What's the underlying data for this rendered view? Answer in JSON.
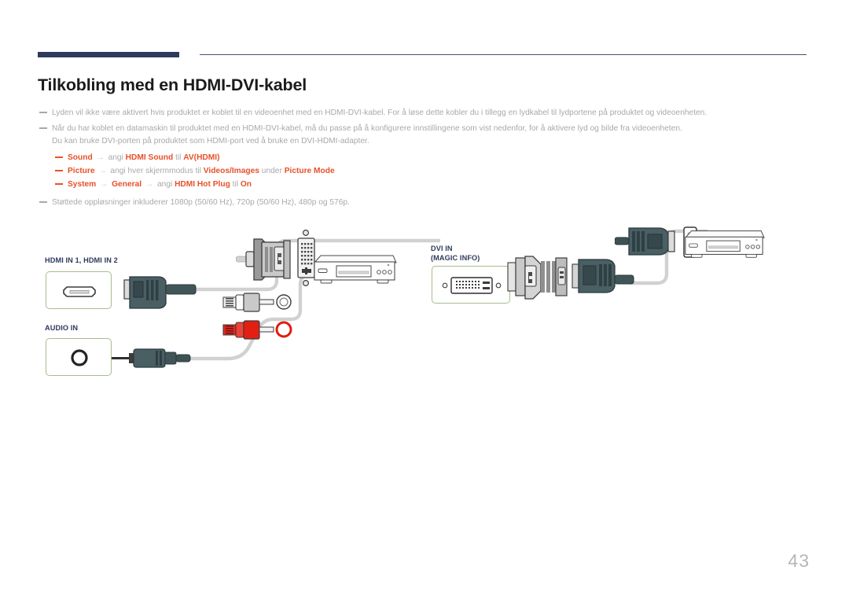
{
  "page": {
    "number": "43",
    "title": "Tilkobling med en HDMI-DVI-kabel",
    "accent_navy": "#2e3a5c",
    "accent_orange": "#e8502a",
    "port_border_green": "#a7bb8e",
    "body_grey": "#a7a9ac"
  },
  "notes": [
    {
      "id": "note-audio",
      "lines": [
        "Lyden vil ikke være aktivert hvis produktet er koblet til en videoenhet med en HDMI-DVI-kabel. For å løse dette kobler du i tillegg en lydkabel til lydportene på produktet og videoenheten."
      ]
    },
    {
      "id": "note-pc",
      "lines": [
        "Når du har koblet en datamaskin til produktet med en HDMI-DVI-kabel, må du passe på å konfigurere innstillingene som vist nedenfor, for å aktivere lyd og bilde fra videoenheten.",
        "Du kan bruke DVI-porten på produktet som HDMI-port ved å bruke en DVI-HDMI-adapter."
      ]
    }
  ],
  "subnotes": [
    {
      "id": "subnote-sound",
      "segments": [
        {
          "text": "Sound",
          "style": "kw"
        },
        {
          "text": "→",
          "style": "arr"
        },
        {
          "text": "angi",
          "style": "plain"
        },
        {
          "text": "HDMI Sound",
          "style": "kw"
        },
        {
          "text": "til",
          "style": "plain"
        },
        {
          "text": "AV(HDMI)",
          "style": "kw"
        }
      ]
    },
    {
      "id": "subnote-picture",
      "segments": [
        {
          "text": "Picture",
          "style": "kw"
        },
        {
          "text": "→",
          "style": "arr"
        },
        {
          "text": "angi hver skjermmodus til",
          "style": "plain"
        },
        {
          "text": "Videos/Images",
          "style": "kw"
        },
        {
          "text": "under",
          "style": "plain"
        },
        {
          "text": "Picture Mode",
          "style": "kw"
        }
      ]
    },
    {
      "id": "subnote-system",
      "segments": [
        {
          "text": "System",
          "style": "kw"
        },
        {
          "text": "→",
          "style": "arr"
        },
        {
          "text": "General",
          "style": "kw"
        },
        {
          "text": "→",
          "style": "arr"
        },
        {
          "text": "angi",
          "style": "plain"
        },
        {
          "text": "HDMI Hot Plug",
          "style": "kw"
        },
        {
          "text": "til",
          "style": "plain"
        },
        {
          "text": "On",
          "style": "kw"
        }
      ]
    }
  ],
  "last_note": {
    "text": "Støttede oppløsninger inkluderer 1080p (50/60 Hz), 720p (50/60 Hz), 480p og 576p."
  },
  "diagram": {
    "left_group": {
      "hdmi_port_label": "HDMI IN 1, HDMI IN 2",
      "audio_port_label": "AUDIO IN",
      "icons": [
        "hdmi-port-icon",
        "hdmi-plug-icon",
        "audio-jack-port-icon",
        "audio-jack-plug-icon",
        "dvi-to-hdmi-adapter-icon",
        "dvi-connector-icon",
        "rca-white-plug-icon",
        "rca-red-plug-icon",
        "rca-white-jack-icon",
        "rca-red-jack-icon",
        "video-device-icon"
      ]
    },
    "right_group": {
      "dvi_port_label_line1": "DVI IN",
      "dvi_port_label_line2": "(MAGIC INFO)",
      "icons": [
        "dvi-port-icon",
        "dvi-to-hdmi-adapter-icon",
        "hdmi-plug-icon",
        "hdmi-port-small-icon",
        "video-device-icon"
      ]
    }
  }
}
